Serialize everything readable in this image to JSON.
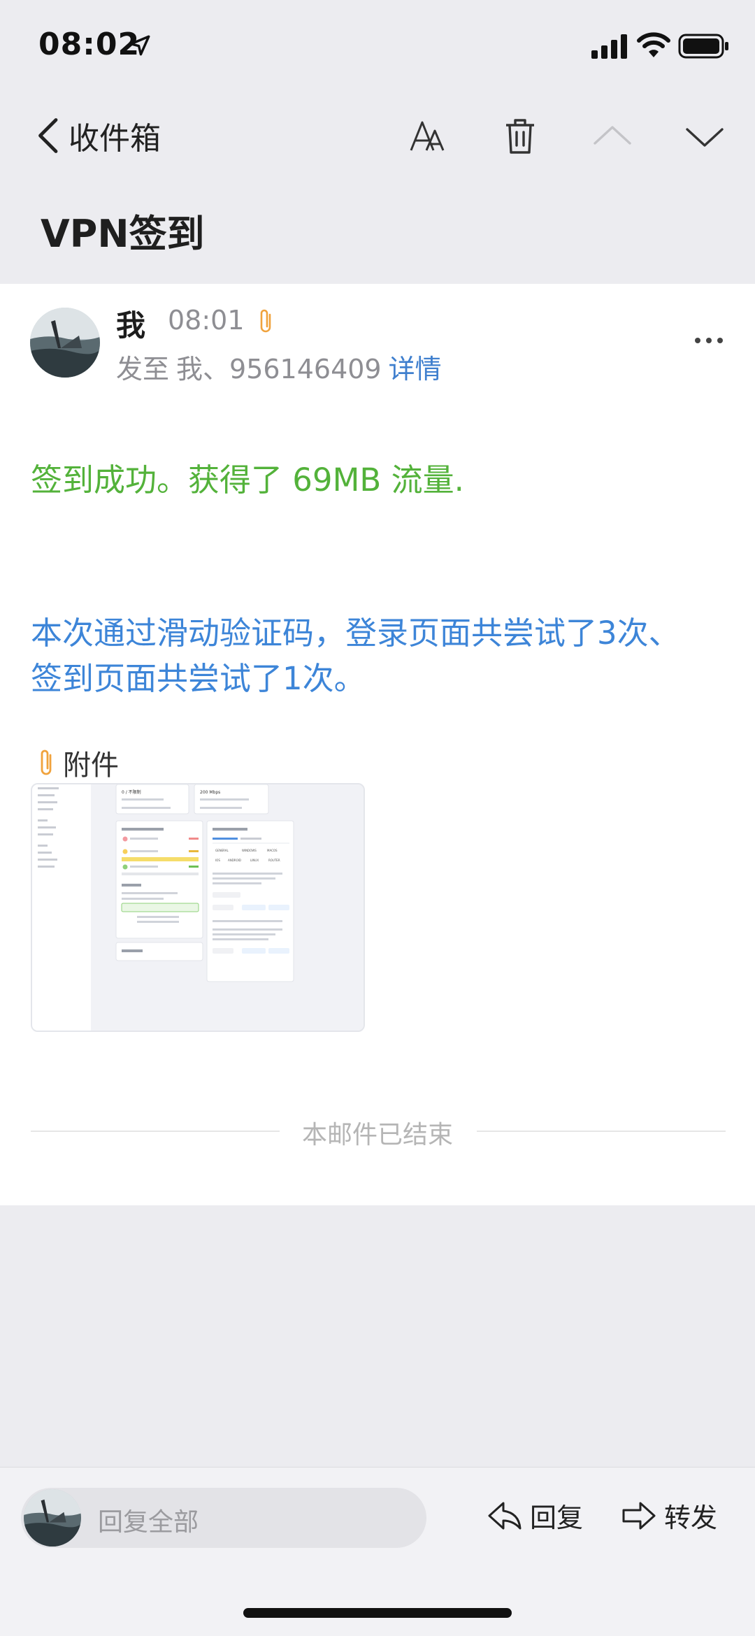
{
  "status_bar": {
    "time": "08:02"
  },
  "nav": {
    "back_label": "收件箱"
  },
  "subject": "VPN签到",
  "mail": {
    "sender": "我",
    "time": "08:01",
    "to_prefix": "发至",
    "recipients": "我、956146409",
    "details_link": "详情",
    "body_line1": "签到成功。获得了 69MB 流量.",
    "body_line2": "本次通过滑动验证码，登录页面共尝试了3次、签到页面共尝试了1次。",
    "attachments_label": "附件",
    "end_notice": "本邮件已结束"
  },
  "bottom_bar": {
    "reply_all": "回复全部",
    "reply": "回复",
    "forward": "转发"
  },
  "attachment_thumb": {
    "l1": "0 / 不限制",
    "l2": "200 Mbps",
    "l3": "GENERAL",
    "l4": "WINDOWS",
    "l5": "MACOS",
    "l6": "IOS",
    "l7": "ANDROID",
    "l8": "LINUX",
    "l9": "ROUTER"
  },
  "colors": {
    "success_green": "#53b23a",
    "info_blue": "#3d85d8",
    "link_blue": "#3f7fce",
    "attachment_orange": "#f0a23c"
  }
}
